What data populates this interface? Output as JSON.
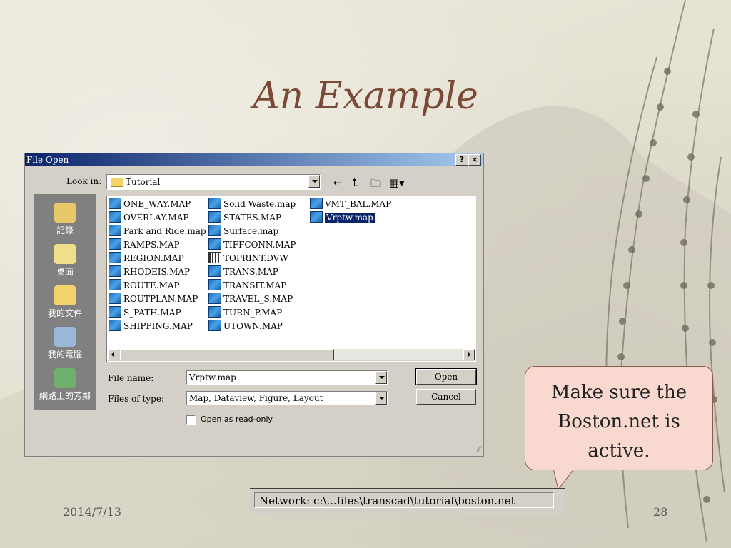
{
  "slide": {
    "title": "An Example",
    "date": "2014/7/13",
    "page_number": "28"
  },
  "dialog": {
    "title": "File Open",
    "help_button": "?",
    "close_button": "×",
    "look_in_label": "Look in:",
    "look_in_value": "Tutorial",
    "places": [
      "記錄",
      "桌面",
      "我的文件",
      "我的電腦",
      "網路上的芳鄰"
    ],
    "files": {
      "col1": [
        "ONE_WAY.MAP",
        "OVERLAY.MAP",
        "Park and Ride.map",
        "RAMPS.MAP",
        "REGION.MAP",
        "RHODEIS.MAP",
        "ROUTE.MAP",
        "ROUTPLAN.MAP",
        "S_PATH.MAP",
        "SHIPPING.MAP"
      ],
      "col2": [
        "Solid Waste.map",
        "STATES.MAP",
        "Surface.map",
        "TIFFCONN.MAP",
        "TOPRINT.DVW",
        "TRANS.MAP",
        "TRANSIT.MAP",
        "TRAVEL_S.MAP",
        "TURN_P.MAP",
        "UTOWN.MAP"
      ],
      "col3": [
        "VMT_BAL.MAP",
        "Vrptw.map"
      ]
    },
    "selected_file": "Vrptw.map",
    "file_name_label": "File name:",
    "file_name_value": "Vrptw.map",
    "files_of_type_label": "Files of type:",
    "files_of_type_value": "Map, Dataview, Figure, Layout",
    "open_button": "Open",
    "cancel_button": "Cancel",
    "readonly_label": "Open as read-only"
  },
  "callout": {
    "text": "Make sure the Boston.net is active."
  },
  "statusbar": {
    "text": "Network: c:\\...files\\transcad\\tutorial\\boston.net"
  },
  "colors": {
    "title": "#7a4a36",
    "dialog_bg": "#d4d0c8",
    "titlebar_start": "#0a246a",
    "titlebar_end": "#a6caf0",
    "callout_bg": "#f9d9cf"
  }
}
